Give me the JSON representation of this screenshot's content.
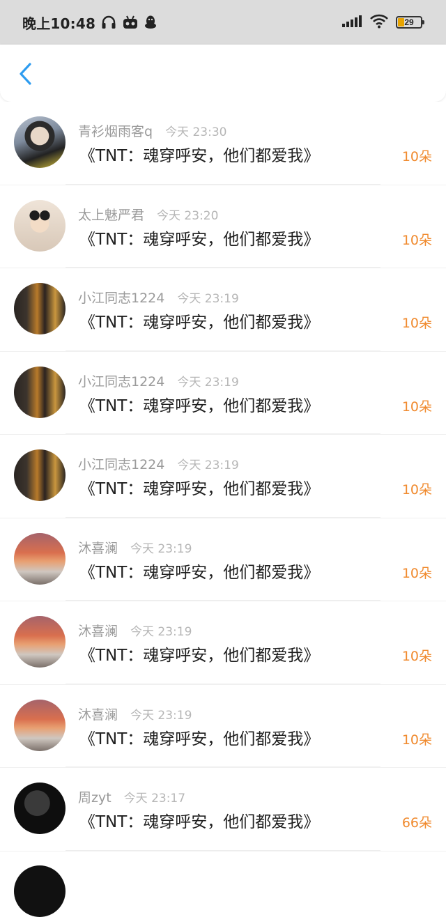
{
  "status_bar": {
    "time": "晚上10:48",
    "battery": "29",
    "icons": [
      "headphones-icon",
      "robot-icon",
      "qq-icon",
      "signal-icon",
      "wifi-icon",
      "battery-icon"
    ]
  },
  "nav": {
    "back_icon": "chevron-left-icon"
  },
  "colors": {
    "accent_orange": "#f08a2e",
    "back_blue": "#2d9cf0",
    "status_bg": "#dcdcdc"
  },
  "list": {
    "items": [
      {
        "name": "青衫烟雨客q",
        "time": "今天 23:30",
        "title": "《TNT：魂穿呼安，他们都爱我》",
        "amount": "10朵"
      },
      {
        "name": "太上魅严君",
        "time": "今天 23:20",
        "title": "《TNT：魂穿呼安，他们都爱我》",
        "amount": "10朵"
      },
      {
        "name": "小江同志1224",
        "time": "今天 23:19",
        "title": "《TNT：魂穿呼安，他们都爱我》",
        "amount": "10朵"
      },
      {
        "name": "小江同志1224",
        "time": "今天 23:19",
        "title": "《TNT：魂穿呼安，他们都爱我》",
        "amount": "10朵"
      },
      {
        "name": "小江同志1224",
        "time": "今天 23:19",
        "title": "《TNT：魂穿呼安，他们都爱我》",
        "amount": "10朵"
      },
      {
        "name": "沐喜澜",
        "time": "今天 23:19",
        "title": "《TNT：魂穿呼安，他们都爱我》",
        "amount": "10朵"
      },
      {
        "name": "沐喜澜",
        "time": "今天 23:19",
        "title": "《TNT：魂穿呼安，他们都爱我》",
        "amount": "10朵"
      },
      {
        "name": "沐喜澜",
        "time": "今天 23:19",
        "title": "《TNT：魂穿呼安，他们都爱我》",
        "amount": "10朵"
      },
      {
        "name": "周zyt",
        "time": "今天 23:17",
        "title": "《TNT：魂穿呼安，他们都爱我》",
        "amount": "66朵"
      }
    ]
  }
}
